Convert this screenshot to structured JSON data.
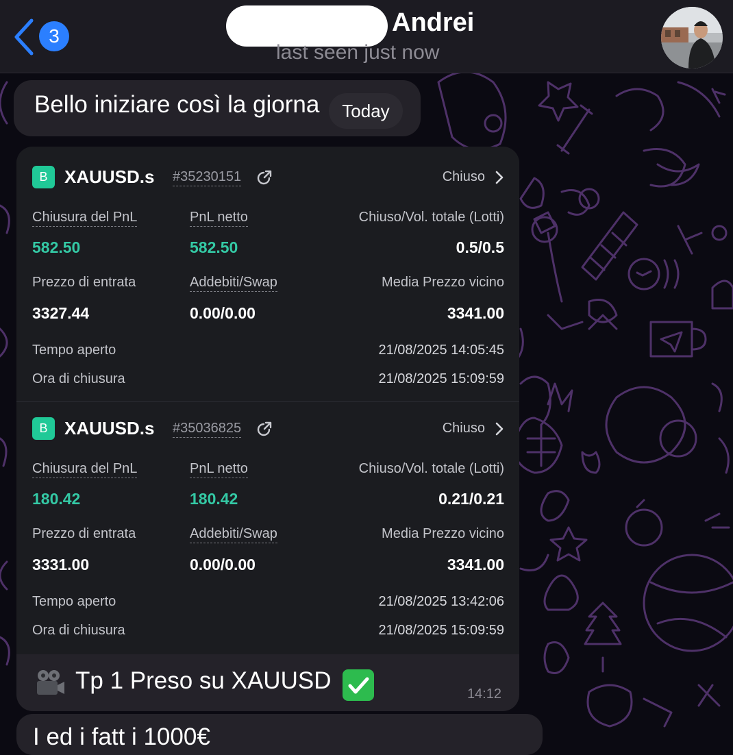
{
  "header": {
    "back_count": "3",
    "contact_name": "Andrei",
    "status": "last seen just now"
  },
  "messages": {
    "previous_text": "Bello iniziare così la giorna",
    "date_separator": "Today",
    "caption": "Tp 1 Preso su XAUUSD",
    "caption_icons": [
      "film-camera-icon",
      "check-mark-icon"
    ],
    "time": "14:12",
    "next_text_partial": "I ed i fatt i 1000€"
  },
  "trades": [
    {
      "icon_letter": "B",
      "symbol": "XAUUSD.s",
      "order_id": "#35230151",
      "status": "Chiuso",
      "labels": {
        "closing_pnl": "Chiusura del PnL",
        "net_pnl": "PnL netto",
        "volume": "Chiuso/Vol. totale (Lotti)",
        "entry_price": "Prezzo di entrata",
        "charges": "Addebiti/Swap",
        "avg_close": "Media Prezzo vicino",
        "open_time": "Tempo aperto",
        "close_time": "Ora di chiusura"
      },
      "closing_pnl": "582.50",
      "net_pnl": "582.50",
      "volume": "0.5/0.5",
      "entry_price": "3327.44",
      "charges": "0.00/0.00",
      "avg_close": "3341.00",
      "open_time": "21/08/2025 14:05:45",
      "close_time": "21/08/2025 15:09:59"
    },
    {
      "icon_letter": "B",
      "symbol": "XAUUSD.s",
      "order_id": "#35036825",
      "status": "Chiuso",
      "labels": {
        "closing_pnl": "Chiusura del PnL",
        "net_pnl": "PnL netto",
        "volume": "Chiuso/Vol. totale (Lotti)",
        "entry_price": "Prezzo di entrata",
        "charges": "Addebiti/Swap",
        "avg_close": "Media Prezzo vicino",
        "open_time": "Tempo aperto",
        "close_time": "Ora di chiusura"
      },
      "closing_pnl": "180.42",
      "net_pnl": "180.42",
      "volume": "0.21/0.21",
      "entry_price": "3331.00",
      "charges": "0.00/0.00",
      "avg_close": "3341.00",
      "open_time": "21/08/2025 13:42:06",
      "close_time": "21/08/2025 15:09:59"
    }
  ],
  "colors": {
    "accent_blue": "#2b7fff",
    "profit_green": "#34c9a5",
    "badge_green": "#20c997",
    "wallpaper_doodle": "#5b3a78"
  }
}
